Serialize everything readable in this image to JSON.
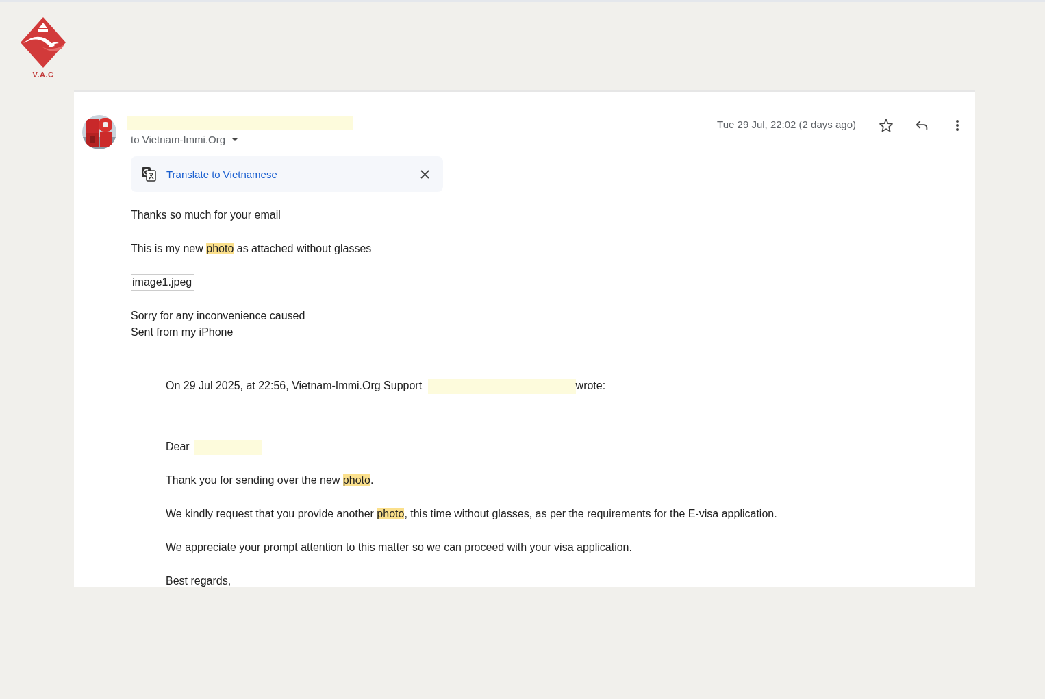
{
  "logo": {
    "text": "V.A.C"
  },
  "email": {
    "recipient": "to Vietnam-Immi.Org",
    "date": "Tue 29 Jul, 22:02 (2 days ago)",
    "starred": false,
    "translate": {
      "label": "Translate to Vietnamese"
    },
    "body": [
      {
        "kind": "paragraph",
        "segments": [
          {
            "kind": "text",
            "text": "Thanks so much for your email"
          }
        ]
      },
      {
        "kind": "paragraph",
        "segments": [
          {
            "kind": "text",
            "text": "This is my new "
          },
          {
            "kind": "highlight",
            "text": "photo"
          },
          {
            "kind": "text",
            "text": " as attached without glasses"
          }
        ]
      },
      {
        "kind": "attachment",
        "text": "image1.jpeg"
      },
      {
        "kind": "lines",
        "lines": [
          "Sorry for any inconvenience caused",
          "Sent from my iPhone"
        ]
      }
    ],
    "quote": [
      {
        "kind": "intro",
        "segments": [
          {
            "kind": "text",
            "text": "On 29 Jul 2025, at 22:56, Vietnam-Immi.Org Support "
          },
          {
            "kind": "redaction"
          },
          {
            "kind": "text",
            "text": "wrote:"
          }
        ]
      },
      {
        "kind": "paragraph",
        "segments": [
          {
            "kind": "text",
            "text": "Dear "
          },
          {
            "kind": "redaction"
          }
        ]
      },
      {
        "kind": "paragraph",
        "segments": [
          {
            "kind": "text",
            "text": "Thank you for sending over the new "
          },
          {
            "kind": "highlight",
            "text": "photo"
          },
          {
            "kind": "text",
            "text": "."
          }
        ]
      },
      {
        "kind": "paragraph",
        "segments": [
          {
            "kind": "text",
            "text": "We kindly request that you provide another "
          },
          {
            "kind": "highlight",
            "text": "photo"
          },
          {
            "kind": "text",
            "text": ", this time without glasses, as per the requirements for the E-visa application."
          }
        ]
      },
      {
        "kind": "paragraph",
        "segments": [
          {
            "kind": "text",
            "text": "We appreciate your prompt attention to this matter so we can proceed with your visa application."
          }
        ]
      },
      {
        "kind": "paragraph",
        "segments": [
          {
            "kind": "text",
            "text": "Best regards,"
          }
        ]
      }
    ]
  }
}
